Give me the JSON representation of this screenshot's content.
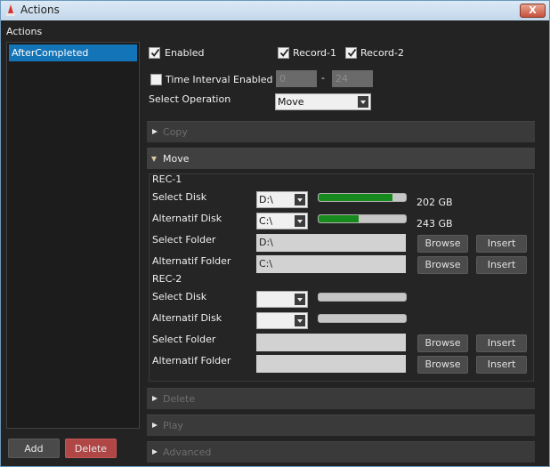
{
  "window": {
    "title": "Actions",
    "close_label": "X"
  },
  "left": {
    "section_title": "Actions",
    "list": [
      {
        "label": "AfterCompleted",
        "selected": true
      }
    ],
    "add_label": "Add",
    "delete_label": "Delete"
  },
  "options": {
    "enabled": {
      "label": "Enabled",
      "checked": true
    },
    "record1": {
      "label": "Record-1",
      "checked": true
    },
    "record2": {
      "label": "Record-2",
      "checked": true
    },
    "time_interval": {
      "label": "Time Interval Enabled",
      "checked": false,
      "from": "0",
      "separator": "-",
      "to": "24"
    },
    "select_operation": {
      "label": "Select Operation",
      "value": "Move"
    }
  },
  "accordion": {
    "copy": "Copy",
    "move": "Move",
    "delete": "Delete",
    "play": "Play",
    "advanced": "Advanced"
  },
  "move": {
    "rec1": {
      "title": "REC-1",
      "select_disk": {
        "label": "Select Disk",
        "value": "D:\\",
        "usage_fraction": 0.85,
        "free": "202 GB"
      },
      "alt_disk": {
        "label": "Alternatif Disk",
        "value": "C:\\",
        "usage_fraction": 0.46,
        "free": "243 GB"
      },
      "select_folder": {
        "label": "Select Folder",
        "value": "D:\\"
      },
      "alt_folder": {
        "label": "Alternatif Folder",
        "value": "C:\\"
      }
    },
    "rec2": {
      "title": "REC-2",
      "select_disk": {
        "label": "Select Disk",
        "value": "",
        "usage_fraction": 0
      },
      "alt_disk": {
        "label": "Alternatif Disk",
        "value": "",
        "usage_fraction": 0
      },
      "select_folder": {
        "label": "Select Folder",
        "value": ""
      },
      "alt_folder": {
        "label": "Alternatif Folder",
        "value": ""
      }
    },
    "browse_label": "Browse",
    "insert_label": "Insert"
  },
  "colors": {
    "accent": "#1474b8",
    "danger": "#b04646",
    "progress": "#178a1e"
  }
}
